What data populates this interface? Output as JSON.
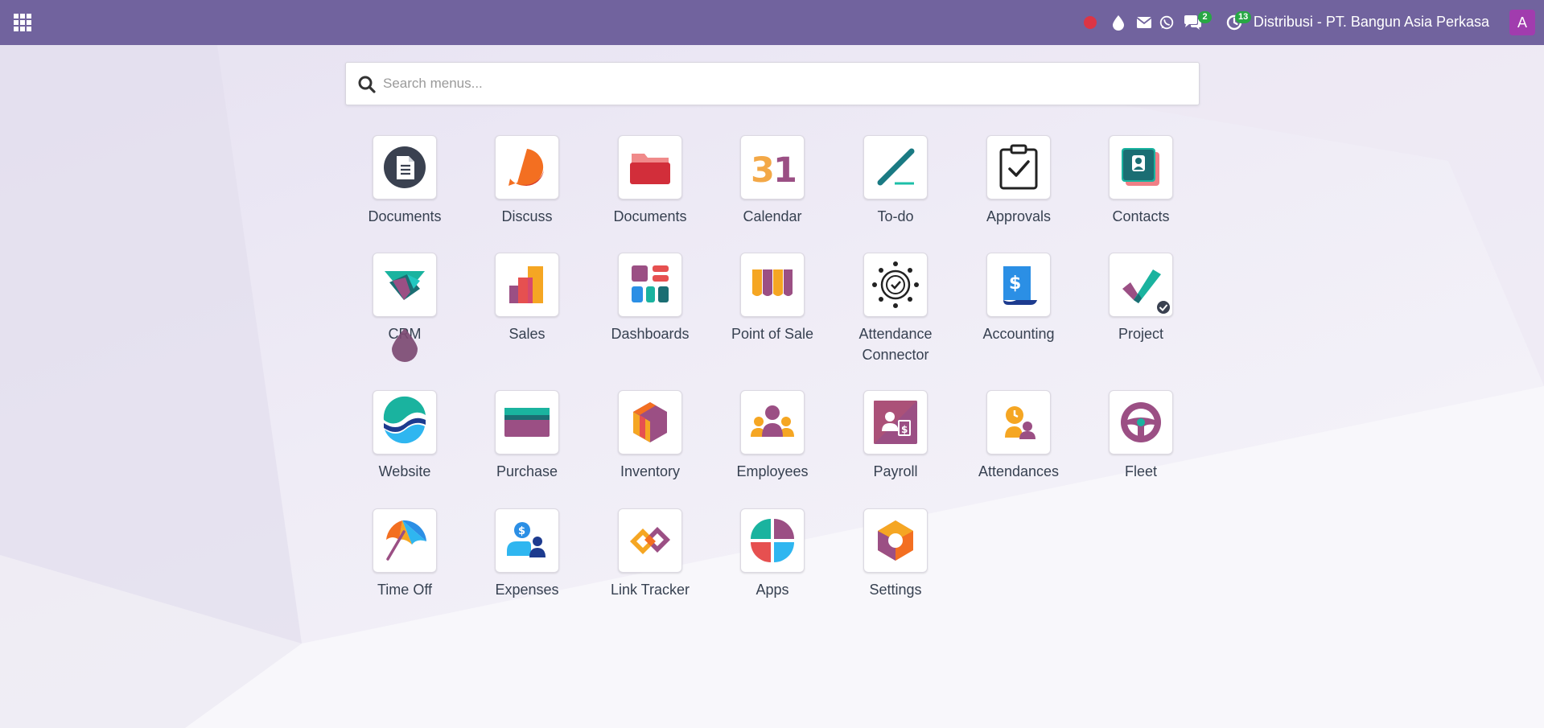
{
  "topbar": {
    "apps_menu_icon": "grid-icon",
    "systray": {
      "recording_icon": "record-dot-icon",
      "drop_icon": "water-drop-icon",
      "mail_icon": "envelope-icon",
      "whatsapp_icon": "whatsapp-icon",
      "messages_icon": "chat-bubbles-icon",
      "messages_count": "2",
      "activities_icon": "clock-icon",
      "activities_count": "13"
    },
    "company_name": "Distribusi - PT. Bangun Asia Perkasa",
    "avatar_letter": "A",
    "bar_color": "#71639e",
    "avatar_color": "#a13cae"
  },
  "search": {
    "placeholder": "Search menus...",
    "value": ""
  },
  "apps": [
    {
      "label": "Documents",
      "icon": "documents-icon"
    },
    {
      "label": "Discuss",
      "icon": "discuss-icon"
    },
    {
      "label": "Documents",
      "icon": "documents-folder-icon"
    },
    {
      "label": "Calendar",
      "icon": "calendar-icon",
      "icon_text": "31"
    },
    {
      "label": "To-do",
      "icon": "todo-icon"
    },
    {
      "label": "Approvals",
      "icon": "approvals-icon"
    },
    {
      "label": "Contacts",
      "icon": "contacts-icon"
    },
    {
      "label": "CRM",
      "icon": "crm-icon"
    },
    {
      "label": "Sales",
      "icon": "sales-icon"
    },
    {
      "label": "Dashboards",
      "icon": "dashboards-icon"
    },
    {
      "label": "Point of Sale",
      "icon": "point-of-sale-icon"
    },
    {
      "label": "Attendance Connector",
      "icon": "attendance-connector-icon"
    },
    {
      "label": "Accounting",
      "icon": "accounting-icon",
      "icon_text": "$"
    },
    {
      "label": "Project",
      "icon": "project-icon"
    },
    {
      "label": "Website",
      "icon": "website-icon"
    },
    {
      "label": "Purchase",
      "icon": "purchase-icon"
    },
    {
      "label": "Inventory",
      "icon": "inventory-icon"
    },
    {
      "label": "Employees",
      "icon": "employees-icon"
    },
    {
      "label": "Payroll",
      "icon": "payroll-icon",
      "icon_text": "$"
    },
    {
      "label": "Attendances",
      "icon": "attendances-icon"
    },
    {
      "label": "Fleet",
      "icon": "fleet-icon"
    },
    {
      "label": "Time Off",
      "icon": "time-off-icon"
    },
    {
      "label": "Expenses",
      "icon": "expenses-icon",
      "icon_text": "$"
    },
    {
      "label": "Link Tracker",
      "icon": "link-tracker-icon"
    },
    {
      "label": "Apps",
      "icon": "apps-icon"
    },
    {
      "label": "Settings",
      "icon": "settings-icon"
    }
  ]
}
